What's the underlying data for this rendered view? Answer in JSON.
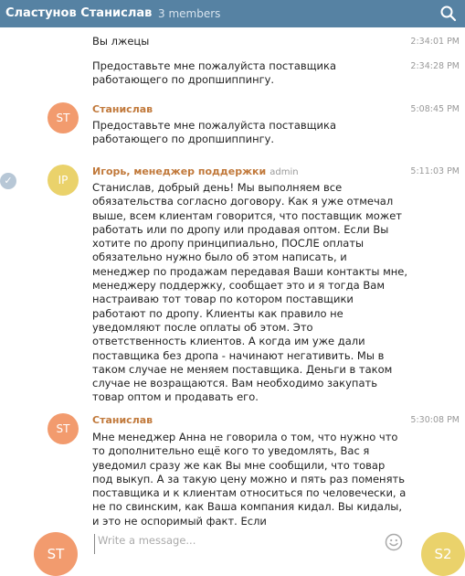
{
  "header": {
    "title": "Сластунов Станислав. П...",
    "members": "3 members",
    "search_icon": "search-icon"
  },
  "messages": [
    {
      "text": "Вы лжецы",
      "time": "2:34:01 PM"
    },
    {
      "text": "Предоставьте мне пожалуйста поставщика работающего по дропшиппингу.",
      "time": "2:34:28 PM"
    },
    {
      "avatar": "ST",
      "author": "Станислав",
      "text": "Предоставьте мне пожалуйста поставщика работающего по дропшиппингу.",
      "time": "5:08:45 PM"
    },
    {
      "avatar": "IP",
      "author": "Игорь, менеджер поддержки",
      "badge": "admin",
      "text": "Станислав, добрый день! Мы выполняем все обязательства согласно договору.  Как я уже отмечал выше, всем клиентам говорится, что поставщик может работать или по дропу или продавая оптом. Если Вы хотите по дропу принципиально, ПОСЛЕ оплаты обязательно нужно было об этом написать, и менеджер по продажам передавая Ваши контакты мне, менеджеру поддержку, сообщает это и я тогда Вам настраиваю тот товар по котором поставщики работают по дропу. Клиенты как правило не уведомляют после оплаты об этом. Это ответственность клиентов. А когда им уже дали поставщика без дропа - начинают негативить. Мы в таком случае не меняем поставщика. Деньги в таком случае не возращаются. Вам необходимо закупать товар оптом и продавать его.",
      "time": "5:11:03 PM"
    },
    {
      "avatar": "ST",
      "author": "Станислав",
      "text": "Мне менеджер Анна не говорила о том, что нужно что то дополнительно ещё кого то уведомлять, Вас я уведомил сразу же как Вы мне сообщили, что товар под выкуп. А за такую цену можно и пять раз поменять поставщика и к клиентам относиться по человечески, а не по свинским, как Ваша компания кидал. Вы кидалы, и это не оспоримый факт. Если",
      "time": "5:30:08 PM"
    }
  ],
  "composer": {
    "my_avatar": "ST",
    "placeholder": "Write a message...",
    "emoji_icon": "smile-icon",
    "peer_avatar": "S2"
  },
  "colors": {
    "header_bg": "#5682a3",
    "author_name": "#c1793b",
    "avatar_st": "#f29b6e",
    "avatar_ip": "#ead26b"
  }
}
